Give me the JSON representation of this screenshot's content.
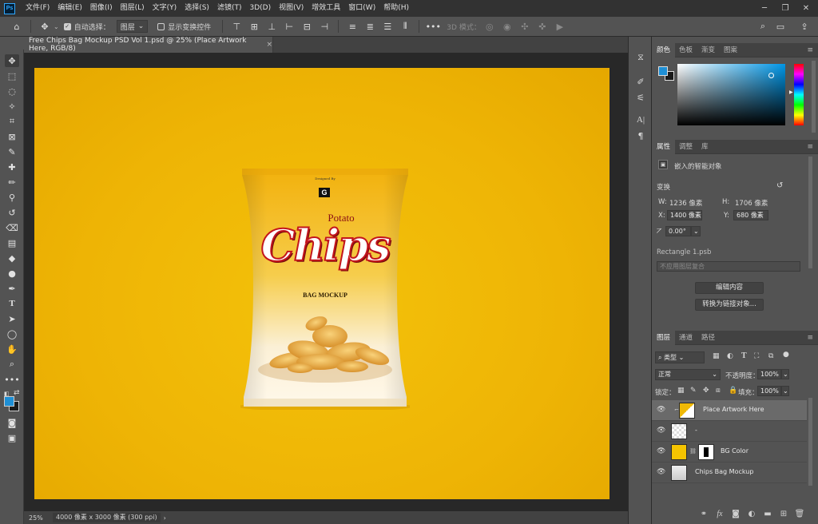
{
  "app": {
    "logo": "Ps"
  },
  "menu": [
    "文件(F)",
    "编辑(E)",
    "图像(I)",
    "图层(L)",
    "文字(Y)",
    "选择(S)",
    "滤镜(T)",
    "3D(D)",
    "视图(V)",
    "增效工具",
    "窗口(W)",
    "帮助(H)"
  ],
  "options": {
    "auto_select_label": "自动选择：",
    "auto_select_target": "图层",
    "show_transform_label": "显示变换控件",
    "mode_3d_label": "3D 模式："
  },
  "document": {
    "tab_title": "Free Chips Bag Mockup PSD Vol 1.psd @ 25% (Place Artwork Here, RGB/8)",
    "zoom": "25%",
    "info": "4000 像素 x 3000 像素 (300 ppi)"
  },
  "artwork": {
    "designed_by": "Designed By",
    "brand_letter": "G",
    "potato": "Potato",
    "chips": "Chips",
    "subtitle": "BAG MOCKUP"
  },
  "color_panel": {
    "tabs": [
      "颜色",
      "色板",
      "渐变",
      "图案"
    ],
    "foreground": "#1e8fd5",
    "background": "#1a1a1a"
  },
  "properties": {
    "tabs": [
      "属性",
      "调整",
      "库"
    ],
    "type_label": "嵌入的智能对象",
    "transform_label": "变换",
    "w_label": "W:",
    "w_value": "1236 像素",
    "h_label": "H:",
    "h_value": "1706 像素",
    "x_label": "X:",
    "x_value": "1400 像素",
    "y_label": "Y:",
    "y_value": "680 像素",
    "angle_value": "0.00°",
    "smart_object_file": "Rectangle 1.psb",
    "layer_comp_placeholder": "不应用图层复合",
    "edit_contents_button": "编辑内容",
    "convert_linked_button": "转换为链接对象..."
  },
  "layers_panel": {
    "tabs": [
      "图层",
      "通道",
      "路径"
    ],
    "filter_kind": "类型",
    "blend_mode": "正常",
    "opacity_label": "不透明度：",
    "opacity_value": "100%",
    "lock_label": "锁定：",
    "fill_label": "填充：",
    "fill_value": "100%",
    "layers": [
      {
        "name": "Place Artwork Here",
        "selected": true
      },
      {
        "name": "-",
        "selected": false
      },
      {
        "name": "BG Color",
        "selected": false
      },
      {
        "name": "Chips Bag Mockup",
        "selected": false
      }
    ]
  },
  "colors": {
    "accent": "#31a8ff",
    "artboard": "#f0b905"
  }
}
